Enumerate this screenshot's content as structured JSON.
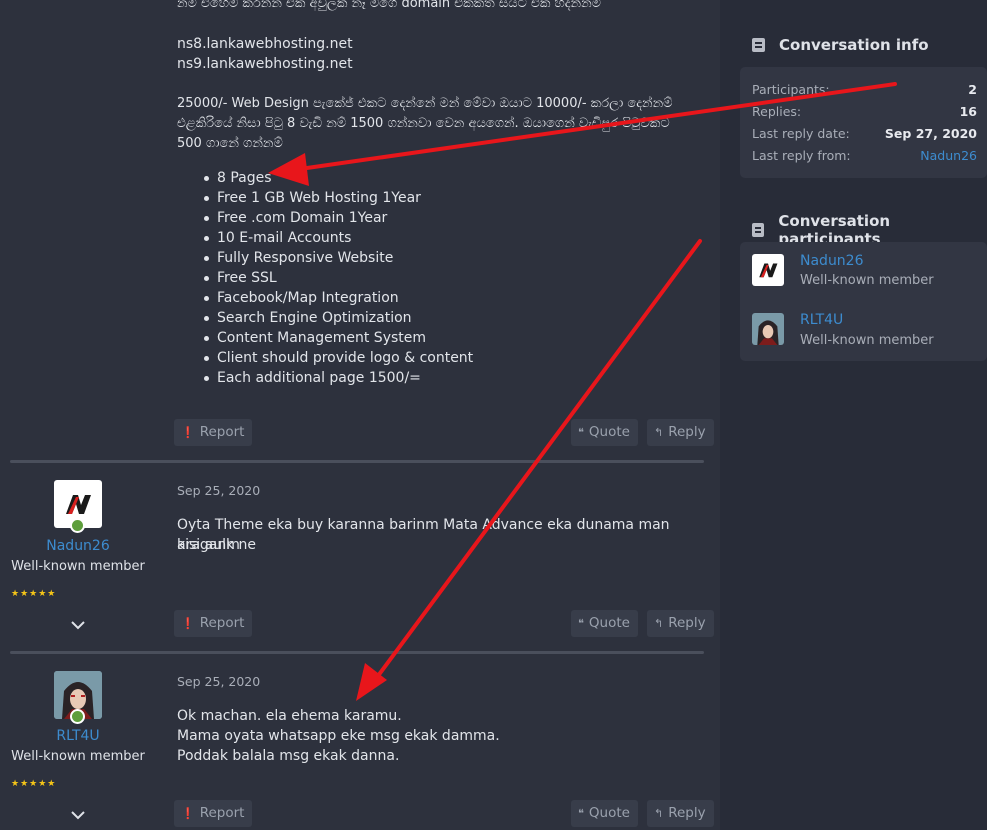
{
  "post1": {
    "line_top": "නම එහෙම කරන්න එක අවුලක් නෑ මගෙ domain එකකත් සයිට් එක හදන්නම",
    "ns1": "ns8.lankawebhosting.net",
    "ns2": "ns9.lankawebhosting.net",
    "offer_l1": "25000/- Web Design පැකේජ් එකට දෙන්නේ මන් මේවා ඔයාට 10000/- කරලා දෙන්නම්",
    "offer_l2": "එළකිරියේ නිසා පිටු 8 වැඩි නම් 1500 ගන්නවා වෙන අයගෙන්. ඔයාගෙන් වැඩිපුර පිටුවකට",
    "offer_l3": "500 ගානේ ගන්නම්",
    "features": [
      "8 Pages",
      "Free 1 GB Web Hosting 1Year",
      "Free .com Domain 1Year",
      "10 E-mail Accounts",
      "Fully Responsive Website",
      "Free SSL",
      "Facebook/Map Integration",
      "Search Engine Optimization",
      "Content Management System",
      "Client should provide logo & content",
      "Each additional page 1500/="
    ]
  },
  "actions": {
    "report": "Report",
    "quote": "Quote",
    "reply": "Reply"
  },
  "post2": {
    "author": "Nadun26",
    "title": "Well-known member",
    "date": "Sep 25, 2020",
    "line1": "Oyta Theme eka buy karanna barinm Mata Advance eka dunama man araganm",
    "line2": "kisi aulk ne"
  },
  "post3": {
    "author": "RLT4U",
    "title": "Well-known member",
    "date": "Sep 25, 2020",
    "line1": "Ok machan. ela ehema karamu.",
    "line2": "Mama oyata whatsapp eke msg ekak damma.",
    "line3": "Poddak balala msg ekak danna."
  },
  "sidebar": {
    "info_title": "Conversation info",
    "info": {
      "participants_k": "Participants:",
      "participants_v": "2",
      "replies_k": "Replies:",
      "replies_v": "16",
      "last_date_k": "Last reply date:",
      "last_date_v": "Sep 27, 2020",
      "last_from_k": "Last reply from:",
      "last_from_v": "Nadun26"
    },
    "participants_title": "Conversation participants",
    "participants": [
      {
        "name": "Nadun26",
        "title": "Well-known member"
      },
      {
        "name": "RLT4U",
        "title": "Well-known member"
      }
    ]
  },
  "colors": {
    "accent": "#3d8ccf",
    "arrow": "#e8161b",
    "online": "#5e9e3c",
    "stars": "#f5c518"
  }
}
